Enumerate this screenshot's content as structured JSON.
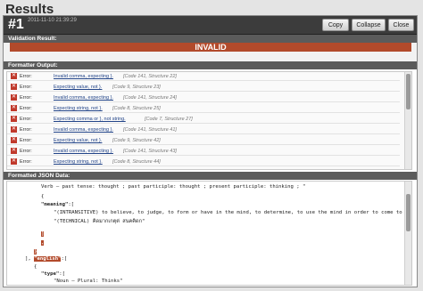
{
  "page": {
    "title": "Results"
  },
  "result": {
    "number": "#1",
    "timestamp": "2011-11-10 21:39:29",
    "buttons": {
      "copy": "Copy",
      "collapse": "Collapse",
      "close": "Close"
    }
  },
  "validation": {
    "heading": "Validation Result:",
    "status": "INVALID"
  },
  "formatter": {
    "heading": "Formatter Output:",
    "errors": [
      {
        "label": "Error:",
        "message": "Invalid comma, expecting }.",
        "code": "[Code 141, Structure 22]"
      },
      {
        "label": "Error:",
        "message": "Expecting value, not }.",
        "code": "[Code 9, Structure 23]"
      },
      {
        "label": "Error:",
        "message": "Invalid comma, expecting }.",
        "code": "[Code 141, Structure 24]"
      },
      {
        "label": "Error:",
        "message": "Expecting string, not }.",
        "code": "[Code 8, Structure 25]"
      },
      {
        "label": "Error:",
        "message": "Expecting comma or }, not string.",
        "code": "[Code 7, Structure 27]"
      },
      {
        "label": "Error:",
        "message": "Invalid comma, expecting }.",
        "code": "[Code 141, Structure 41]"
      },
      {
        "label": "Error:",
        "message": "Expecting value, not }.",
        "code": "[Code 9, Structure 42]"
      },
      {
        "label": "Error:",
        "message": "Invalid comma, expecting }.",
        "code": "[Code 141, Structure 43]"
      },
      {
        "label": "Error:",
        "message": "Expecting string, not }.",
        "code": "[Code 8, Structure 44]"
      }
    ]
  },
  "json_view": {
    "heading": "Formatted JSON Data:",
    "lines": {
      "l1": "Verb — past tense: thought ; past participle: thought ; present participle: thinking ; \"",
      "l2_open": "{",
      "l3_key": "\"meaning\"",
      "l3_rest": ":[",
      "l4": "\"(INTRANSITIVE) to believe, to judge, to form or have in the mind, to determine, to use the mind in order to come to",
      "l5": "\"(TECHNICAL) คิดมากเกตุต่ สนคคิดก\"",
      "l6": "]",
      "l7": ",",
      "l8": "}",
      "l9_bracket": "],",
      "l9_key": "\"english\"",
      "l9_rest": ":[",
      "l10": "{",
      "l11_key": "\"type\"",
      "l11_rest": ":[",
      "l12": "\"Noun — Plural: Thinks\"",
      "l13": "],"
    }
  }
}
